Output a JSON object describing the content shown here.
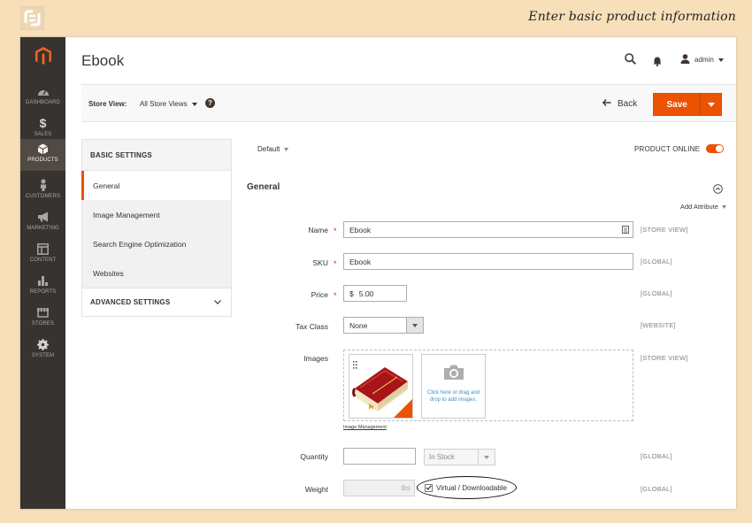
{
  "caption": "Enter basic product information",
  "page_title": "Ebook",
  "header": {
    "user": "admin"
  },
  "sidebar": {
    "items": [
      {
        "label": "DASHBOARD",
        "icon": "dashboard-icon",
        "active": false
      },
      {
        "label": "SALES",
        "icon": "dollar-icon",
        "active": false
      },
      {
        "label": "PRODUCTS",
        "icon": "cube-icon",
        "active": true
      },
      {
        "label": "CUSTOMERS",
        "icon": "person-icon",
        "active": false
      },
      {
        "label": "MARKETING",
        "icon": "megaphone-icon",
        "active": false
      },
      {
        "label": "CONTENT",
        "icon": "layout-icon",
        "active": false
      },
      {
        "label": "REPORTS",
        "icon": "bar-chart-icon",
        "active": false
      },
      {
        "label": "STORES",
        "icon": "store-icon",
        "active": false
      },
      {
        "label": "SYSTEM",
        "icon": "gear-icon",
        "active": false
      }
    ]
  },
  "actions": {
    "store_view_label": "Store View:",
    "store_view_value": "All Store Views",
    "help": "?",
    "back": "Back",
    "save": "Save"
  },
  "tabs": {
    "basic_header": "BASIC SETTINGS",
    "items": [
      "General",
      "Image Management",
      "Search Engine Optimization",
      "Websites"
    ],
    "advanced_header": "ADVANCED SETTINGS"
  },
  "form": {
    "attribute_set": "Default",
    "product_online": "PRODUCT ONLINE",
    "section_title": "General",
    "add_attribute": "Add Attribute",
    "name_label": "Name",
    "name_value": "Ebook",
    "name_scope": "[STORE VIEW]",
    "sku_label": "SKU",
    "sku_value": "Ebook",
    "sku_scope": "[GLOBAL]",
    "price_label": "Price",
    "price_currency": "$",
    "price_value": "5.00",
    "price_scope": "[GLOBAL]",
    "tax_label": "Tax Class",
    "tax_value": "None",
    "tax_scope": "[WEBSITE]",
    "images_label": "Images",
    "images_scope": "[STORE VIEW]",
    "upload_text": "Click here or drag and drop to add images.",
    "image_management_link": "Image Management",
    "quantity_label": "Quantity",
    "quantity_value": "",
    "stock_value": "In Stock",
    "quantity_scope": "[GLOBAL]",
    "weight_label": "Weight",
    "weight_unit": "lbs",
    "virtual_label": "Virtual / Downloadable",
    "virtual_checked": true,
    "weight_scope": "[GLOBAL]"
  },
  "colors": {
    "accent": "#eb5202",
    "sidebar": "#373330",
    "page_bg": "#f7dfb9"
  }
}
